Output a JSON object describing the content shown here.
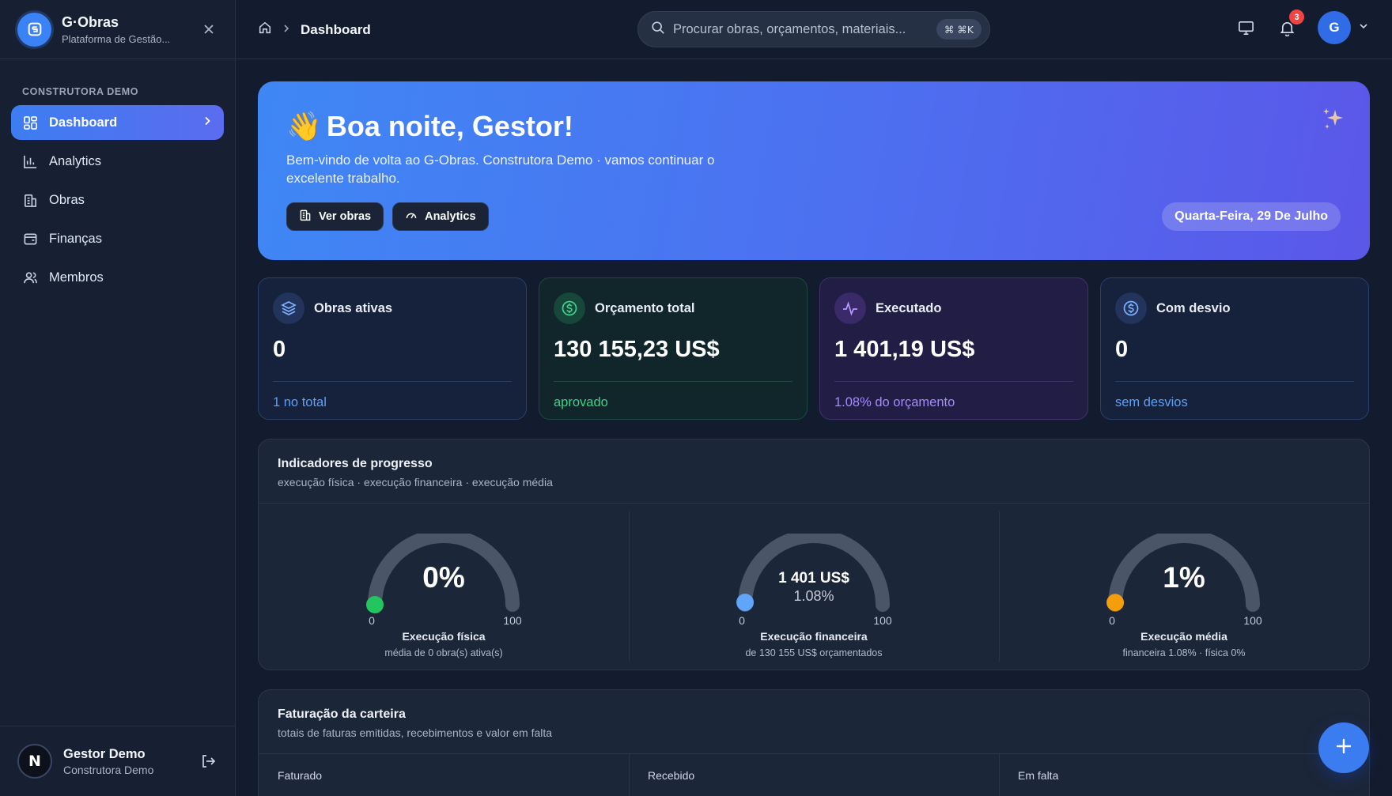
{
  "brand": {
    "title": "G·Obras",
    "subtitle": "Plataforma de Gestão..."
  },
  "sidebar": {
    "org_label": "CONSTRUTORA DEMO",
    "items": [
      {
        "label": "Dashboard",
        "icon": "dashboard-grid-icon",
        "active": true
      },
      {
        "label": "Analytics",
        "icon": "bar-chart-icon",
        "active": false
      },
      {
        "label": "Obras",
        "icon": "building-icon",
        "active": false
      },
      {
        "label": "Finanças",
        "icon": "wallet-icon",
        "active": false
      },
      {
        "label": "Membros",
        "icon": "users-icon",
        "active": false
      }
    ]
  },
  "user": {
    "initial": "N",
    "name": "Gestor Demo",
    "org": "Construtora Demo"
  },
  "topbar": {
    "breadcrumb_current": "Dashboard",
    "search_placeholder": "Procurar obras, orçamentos, materiais...",
    "search_shortcut": "⌘ ⌘K",
    "notifications_count": "3",
    "avatar_initial": "G"
  },
  "hero": {
    "emoji": "👋",
    "title": "Boa noite, Gestor!",
    "subtitle": "Bem-vindo de volta ao G-Obras. Construtora Demo · vamos continuar o excelente trabalho.",
    "btn_obras": "Ver obras",
    "btn_analytics": "Analytics",
    "date": "Quarta-Feira, 29 De Julho"
  },
  "stats": [
    {
      "label": "Obras ativas",
      "value": "0",
      "foot": "1 no total",
      "icon": "layers-icon"
    },
    {
      "label": "Orçamento total",
      "value": "130 155,23 US$",
      "foot": "aprovado",
      "icon": "dollar-circle-icon"
    },
    {
      "label": "Executado",
      "value": "1 401,19 US$",
      "foot": "1.08% do orçamento",
      "icon": "activity-icon"
    },
    {
      "label": "Com desvio",
      "value": "0",
      "foot": "sem desvios",
      "icon": "dollar-circle-icon"
    }
  ],
  "progress": {
    "title": "Indicadores de progresso",
    "subtitle": "execução física · execução financeira · execução média",
    "gauges": [
      {
        "main": "0%",
        "secondary": "",
        "min": "0",
        "max": "100",
        "name": "Execução física",
        "desc": "média de 0 obra(s) ativa(s)",
        "percent": 0,
        "color": "#22c55e"
      },
      {
        "main": "1 401 US$",
        "secondary": "1.08%",
        "min": "0",
        "max": "100",
        "name": "Execução financeira",
        "desc": "de 130 155 US$ orçamentados",
        "percent": 1.08,
        "color": "#60a5fa"
      },
      {
        "main": "1%",
        "secondary": "",
        "min": "0",
        "max": "100",
        "name": "Execução média",
        "desc": "financeira 1.08% · física 0%",
        "percent": 1,
        "color": "#f59e0b"
      }
    ]
  },
  "billing": {
    "title": "Faturação da carteira",
    "subtitle": "totais de faturas emitidas, recebimentos e valor em falta",
    "cols": [
      "Faturado",
      "Recebido",
      "Em falta"
    ]
  },
  "colors": {
    "accent": "#3b82f6",
    "bg": "#131b2e",
    "sidebar": "#172033"
  }
}
